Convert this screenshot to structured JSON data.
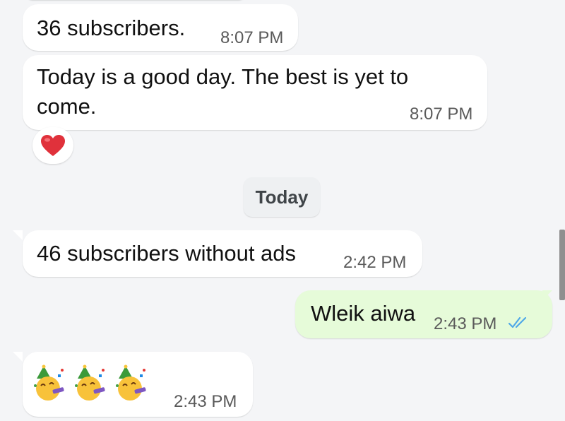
{
  "messages": [
    {
      "text": "36 subscribers.",
      "time": "8:07 PM"
    },
    {
      "text_line1": "Today is a good day. The best is yet to",
      "text_line2": "come.",
      "time": "8:07 PM",
      "reaction": "red-heart-icon"
    },
    {
      "text": "46 subscribers without ads",
      "time": "2:42 PM"
    },
    {
      "text": "Wleik aiwa",
      "time": "2:43 PM",
      "status": "double-check-icon (read)"
    },
    {
      "emojis": [
        "partying-face-icon",
        "partying-face-icon",
        "partying-face-icon"
      ],
      "time": "2:43 PM"
    }
  ],
  "date_divider": "Today",
  "colors": {
    "background": "#f4f5f7",
    "incoming_bubble": "#ffffff",
    "outgoing_bubble": "#e6fbd9",
    "read_ticks": "#4fa8e8",
    "heart": "#e0313b"
  }
}
